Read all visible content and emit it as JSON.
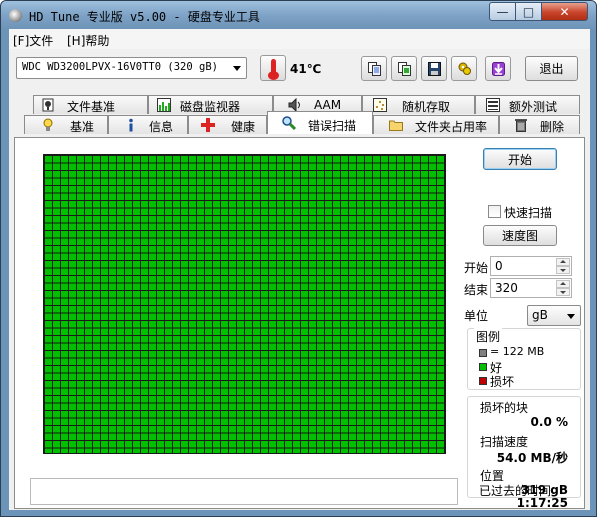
{
  "window": {
    "title": "HD Tune 专业版 v5.00 - 硬盘专业工具",
    "controls": {
      "minimize": "—",
      "maximize": "□",
      "close": "✕"
    }
  },
  "menu": [
    {
      "label": "[F]文件"
    },
    {
      "label": "[H]帮助"
    }
  ],
  "toolbar": {
    "drive": "WDC WD3200LPVX-16V0TT0 (320 gB)",
    "temperature": "41℃",
    "exit_label": "退出",
    "icons": [
      "thermometer-icon",
      "copy-info-icon",
      "copy-screenshot-icon",
      "save-icon",
      "options-icon",
      "download-icon"
    ]
  },
  "tabs_row1": [
    {
      "label": "文件基准",
      "icon": "file-benchmark-icon"
    },
    {
      "label": "磁盘监视器",
      "icon": "disk-monitor-icon"
    },
    {
      "label": "AAM",
      "icon": "speaker-icon"
    },
    {
      "label": "随机存取",
      "icon": "random-access-icon"
    },
    {
      "label": "额外测试",
      "icon": "extra-tests-icon"
    }
  ],
  "tabs_row2": [
    {
      "label": "基准",
      "icon": "benchmark-icon"
    },
    {
      "label": "信息",
      "icon": "info-icon"
    },
    {
      "label": "健康",
      "icon": "health-icon"
    },
    {
      "label": "错误扫描",
      "icon": "magnifier-icon",
      "active": true
    },
    {
      "label": "文件夹占用率",
      "icon": "folder-icon"
    },
    {
      "label": "删除",
      "icon": "trash-icon"
    }
  ],
  "error_scan": {
    "start_button": "开始",
    "quick_scan_label": "快速扫描",
    "quick_scan_checked": false,
    "speed_map_button": "速度图",
    "start_label": "开始",
    "start_value": "0",
    "end_label": "结束",
    "end_value": "320",
    "unit_label": "单位",
    "unit_value": "gB",
    "legend": {
      "title": "图例",
      "block_size": "= 122 MB",
      "good": "好",
      "damaged": "损坏",
      "colors": {
        "block": "#808080",
        "good": "#00c000",
        "damaged": "#c00000"
      }
    },
    "stats": {
      "damaged_blocks_label": "损坏的块",
      "damaged_blocks_value": "0.0 %",
      "scan_speed_label": "扫描速度",
      "scan_speed_value": "54.0 MB/秒",
      "position_label": "位置",
      "position_value": "319 gB",
      "elapsed_label": "已过去的时间",
      "elapsed_value": "1:17:25"
    },
    "grid_state": "all-good"
  }
}
